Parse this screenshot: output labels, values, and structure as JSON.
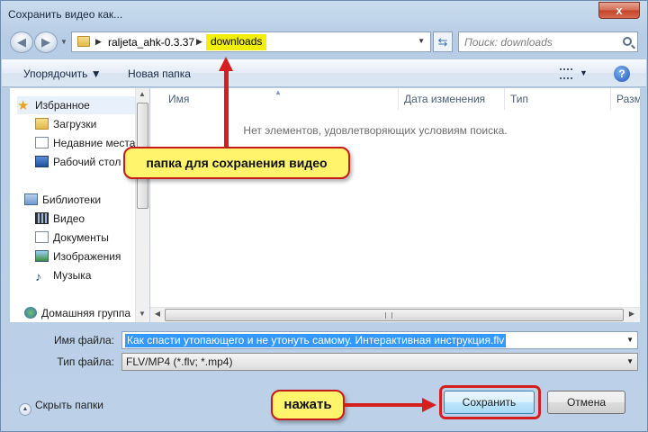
{
  "window": {
    "title": "Сохранить видео как...",
    "close_label": "x"
  },
  "address": {
    "crumbs": [
      "raljeta_ahk-0.3.37",
      "downloads"
    ],
    "search_placeholder": "Поиск: downloads"
  },
  "toolbar": {
    "organize_label": "Упорядочить ▼",
    "new_folder_label": "Новая папка",
    "help_label": "?"
  },
  "sidebar": {
    "items": [
      {
        "label": "Избранное",
        "icon": "star-icon"
      },
      {
        "label": "Загрузки",
        "icon": "downloads-folder-icon"
      },
      {
        "label": "Недавние места",
        "icon": "recent-places-icon"
      },
      {
        "label": "Рабочий стол",
        "icon": "desktop-icon"
      },
      {
        "label": "Библиотеки",
        "icon": "libraries-icon"
      },
      {
        "label": "Видео",
        "icon": "video-icon"
      },
      {
        "label": "Документы",
        "icon": "documents-icon"
      },
      {
        "label": "Изображения",
        "icon": "pictures-icon"
      },
      {
        "label": "Музыка",
        "icon": "music-icon"
      },
      {
        "label": "Домашняя группа",
        "icon": "homegroup-icon"
      }
    ]
  },
  "file_list": {
    "columns": [
      "Имя",
      "Дата изменения",
      "Тип",
      "Размер"
    ],
    "empty_message": "Нет элементов, удовлетворяющих условиям поиска."
  },
  "form": {
    "filename_label": "Имя файла:",
    "filename_value": "Как спасти утопающего и не утонуть самому. Интерактивная инструкция.flv",
    "filetype_label": "Тип файла:",
    "filetype_value": "FLV/MP4 (*.flv; *.mp4)"
  },
  "footer": {
    "hide_folders_label": "Скрыть папки",
    "save_label": "Сохранить",
    "cancel_label": "Отмена"
  },
  "annotations": {
    "folder_callout": "папка для сохранения видео",
    "press_callout": "нажать"
  },
  "colors": {
    "highlight": "#f0f000",
    "annotation_red": "#d51f1f",
    "callout_fill": "#fff46b"
  }
}
